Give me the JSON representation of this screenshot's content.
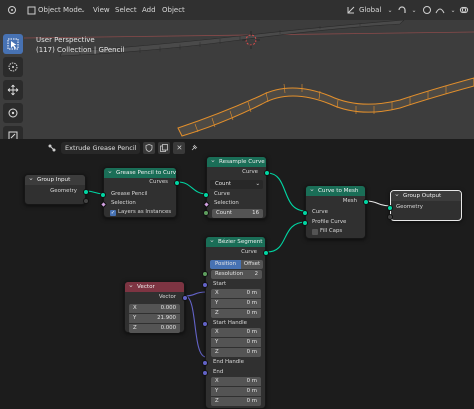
{
  "viewport": {
    "mode_label": "Object Mode",
    "menu": [
      "View",
      "Select",
      "Add",
      "Object"
    ],
    "transform_orientation": "Global",
    "overlay_line1": "User Perspective",
    "overlay_line2": "(117) Collection | GPencil"
  },
  "editor": {
    "node_tree_name": "Extrude Grease Pencil"
  },
  "nodes": {
    "group_input": {
      "title": "Group Input",
      "out_geometry": "Geometry"
    },
    "gp_to_curves": {
      "title": "Grease Pencil to Curves",
      "out_curves": "Curves",
      "in_gp": "Grease Pencil",
      "in_selection": "Selection",
      "layers_label": "Layers as Instances"
    },
    "resample": {
      "title": "Resample Curve",
      "out_curve": "Curve",
      "mode": "Count",
      "in_curve": "Curve",
      "in_selection": "Selection",
      "count_label": "Count",
      "count_value": "16"
    },
    "bezier": {
      "title": "Bézier Segment",
      "out_curve": "Curve",
      "mode_on": "Position",
      "mode_off": "Offset",
      "res_label": "Resolution",
      "res_value": "2",
      "start": "Start",
      "start_handle": "Start Handle",
      "end_handle": "End Handle",
      "end": "End",
      "x": "X",
      "y": "Y",
      "z": "Z",
      "zero": "0 m"
    },
    "vector": {
      "title": "Vector",
      "out_vector": "Vector",
      "x_label": "X",
      "x_value": "0.000",
      "y_label": "Y",
      "y_value": "21.900",
      "z_label": "Z",
      "z_value": "0.000"
    },
    "curve_to_mesh": {
      "title": "Curve to Mesh",
      "out_mesh": "Mesh",
      "in_curve": "Curve",
      "in_profile": "Profile Curve",
      "fill_caps": "Fill Caps"
    },
    "group_output": {
      "title": "Group Output",
      "in_geometry": "Geometry"
    }
  }
}
